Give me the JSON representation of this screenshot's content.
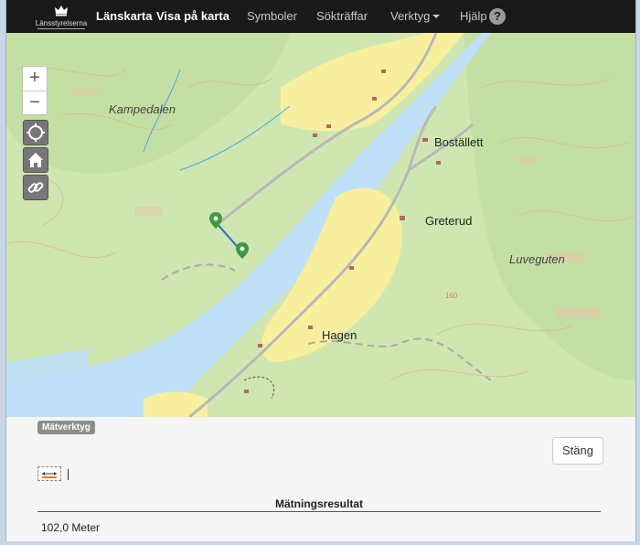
{
  "header": {
    "logo_text": "Länsstyrelserna",
    "nav": {
      "lanskarta": "Länskarta",
      "visa": "Visa på karta",
      "symboler": "Symboler",
      "soktraffar": "Sökträffar",
      "verktyg": "Verktyg",
      "hjalp": "Hjälp",
      "help_icon_text": "?"
    }
  },
  "map": {
    "zoom_in": "+",
    "zoom_out": "−",
    "labels": {
      "kampedalen": "Kampedalen",
      "bostallet": "Boställett",
      "greterud": "Greterud",
      "luveguten": "Luveguten",
      "hagen": "Hagen"
    },
    "colors": {
      "land": "#cfe6b0",
      "water": "#bfe0f7",
      "settlement": "#f7ef9e",
      "road": "#b8b8b8",
      "marker": "#3f9a3f",
      "measure": "#2b67c9"
    }
  },
  "panel": {
    "tag": "Mätverktyg",
    "close_label": "Stäng",
    "results_title": "Mätningsresultat",
    "result_value": "102,0 Meter"
  }
}
